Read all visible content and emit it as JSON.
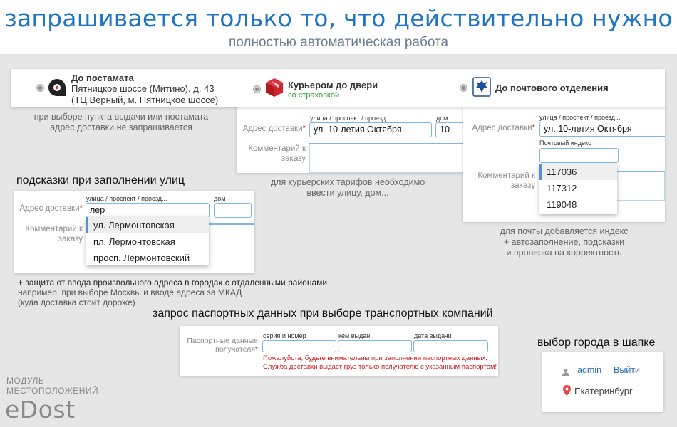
{
  "header": {
    "title": "запрашивается только то, что действительно нужно",
    "subtitle": "полностью автоматическая работа"
  },
  "tabs": {
    "postamat": {
      "title": "До постамата",
      "line1": "Пятницкое шоссе (Митино), д. 43",
      "line2": "(ТЦ Верный, м. Пятницкое шоссе)"
    },
    "courier": {
      "title": "Курьером до двери",
      "sub": "со страховкой"
    },
    "post": {
      "title": "До почтового отделения"
    }
  },
  "postamat_note": [
    "при выборе пункта выдачи или постамата",
    "адрес доставки не запрашивается"
  ],
  "courier_form": {
    "street_caption": "улица / проспект / проезд...",
    "house_caption": "дом",
    "address_label": "Адрес доставки",
    "required": "*",
    "street_value": "ул. 10-летия Октября",
    "house_value": "10",
    "comment_label": [
      "Комментарий к",
      "заказу"
    ],
    "note": [
      "для курьерских тарифов необходимо",
      "ввести улицу, дом..."
    ]
  },
  "post_form": {
    "street_caption": "улица / проспект / проезд...",
    "address_label": "Адрес доставки",
    "required": "*",
    "street_value": "ул. 10-летия Октября",
    "index_caption": "Почтовый индекс",
    "comment_label": [
      "Комментарий к",
      "заказу"
    ],
    "index_options": [
      "117036",
      "117312",
      "119048"
    ],
    "note": [
      "для почты добавляется индекс",
      "+ автозаполнение, подсказки",
      "и проверка на корректность"
    ]
  },
  "street_hints": {
    "heading": "подсказки при заполнении улиц",
    "street_caption": "улица / проспект / проезд...",
    "house_caption": "дом",
    "address_label": "Адрес доставки",
    "required": "*",
    "street_value": "лер",
    "comment_label": [
      "Комментарий к",
      "заказу"
    ],
    "options": [
      "ул. Лермонтовская",
      "пл. Лермонтовская",
      "просп. Лермонтовский"
    ],
    "protect": "+ защита от ввода произвольного адреса в городах с отдаленными районами",
    "example": [
      "например, при выборе Москвы и вводе адреса за МКАД",
      "(куда доставка стоит дороже)"
    ]
  },
  "passport": {
    "heading": "запрос паспортных данных при выборе транспортных компаний",
    "label": [
      "Паспортные данные",
      "получателя"
    ],
    "required": "*",
    "captions": [
      "серия и номер",
      "кем выдан",
      "дата выдачи"
    ],
    "warning": [
      "Пожалуйста, будьте внимательны при заполнении паспортных данных.",
      "Служба доставки выдаст груз только получателю с указанным паспортом!"
    ]
  },
  "city": {
    "heading": "выбор города в шапке",
    "user": "admin",
    "logout": "Выйти",
    "city": "Екатеринбург"
  },
  "brand": {
    "line1": "МОДУЛЬ",
    "line2": "МЕСТОПОЛОЖЕНИЙ",
    "name": "eDost"
  }
}
